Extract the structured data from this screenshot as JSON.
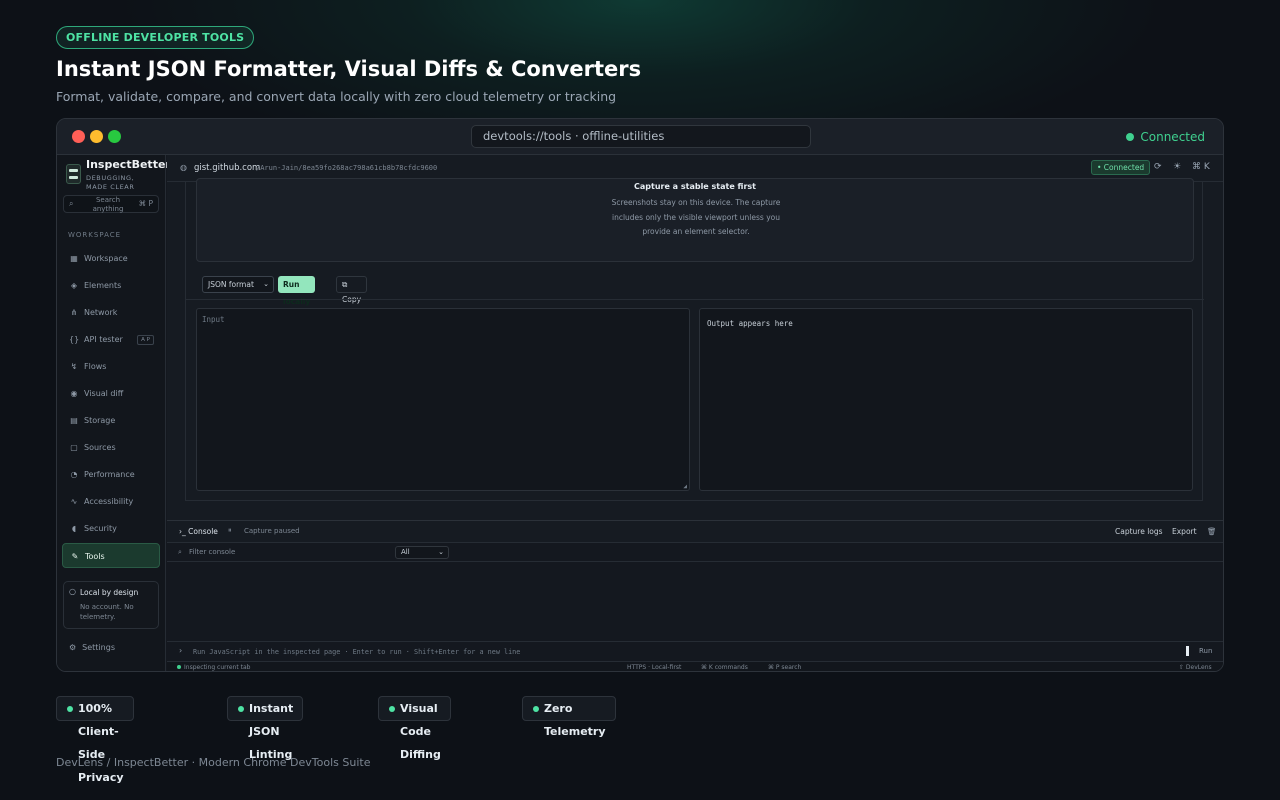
{
  "hero": {
    "badge": "OFFLINE DEVELOPER TOOLS",
    "title": "Instant JSON Formatter, Visual Diffs & Converters",
    "subtitle": "Format, validate, compare, and convert data locally with zero cloud telemetry or tracking"
  },
  "browser": {
    "url": "devtools://tools · offline-utilities",
    "status": "Connected"
  },
  "app": {
    "brand": "InspectBetter",
    "tagline": "DEBUGGING, MADE CLEAR",
    "search_placeholder": "Search anything",
    "search_kbd": "⌘ P",
    "section_label": "WORKSPACE",
    "nav": [
      {
        "label": "Workspace",
        "icon": "grid-icon",
        "glyph": "▦"
      },
      {
        "label": "Elements",
        "icon": "layers-icon",
        "glyph": "◈"
      },
      {
        "label": "Network",
        "icon": "network-icon",
        "glyph": "⋔"
      },
      {
        "label": "API tester",
        "icon": "braces-icon",
        "glyph": "{}",
        "badge": "A P"
      },
      {
        "label": "Flows",
        "icon": "flow-icon",
        "glyph": "↯"
      },
      {
        "label": "Visual diff",
        "icon": "camera-icon",
        "glyph": "◉"
      },
      {
        "label": "Storage",
        "icon": "database-icon",
        "glyph": "▤"
      },
      {
        "label": "Sources",
        "icon": "file-icon",
        "glyph": "▢"
      },
      {
        "label": "Performance",
        "icon": "gauge-icon",
        "glyph": "◔"
      },
      {
        "label": "Accessibility",
        "icon": "pulse-icon",
        "glyph": "∿"
      },
      {
        "label": "Security",
        "icon": "shield-icon",
        "glyph": "◖"
      },
      {
        "label": "Tools",
        "icon": "wrench-icon",
        "glyph": "✎",
        "active": true
      }
    ],
    "local_title": "Local by design",
    "local_desc": "No account. No telemetry.",
    "settings_label": "Settings",
    "topbar": {
      "host": "gist.github.com",
      "path": "/Arun-Jain/8ea59fo268ac798a61cb8b78cfdc9600",
      "connected": "• Connected",
      "icons": [
        "refresh-icon",
        "sun-icon",
        "command-icon"
      ],
      "kbd": "⌘ K"
    },
    "capture": {
      "title": "Capture a stable state first",
      "desc": "Screenshots stay on this device. The capture includes only the visible viewport unless you provide an element selector."
    },
    "tools": {
      "mode": "JSON format",
      "run": "Run locally",
      "copy": "Copy"
    },
    "input_placeholder": "Input",
    "output_placeholder": "Output appears here",
    "console": {
      "title": "Console",
      "pause_glyph": "⏸",
      "paused": "Capture paused",
      "capture_logs": "Capture logs",
      "export": "Export",
      "filter_placeholder": "Filter console",
      "level": "All",
      "prompt": "Run JavaScript in the inspected page · Enter to run · Shift+Enter for a new line",
      "run": "Run"
    },
    "status": {
      "left": "Inspecting current tab",
      "https": "HTTPS · Local-first",
      "commands": "⌘ K commands",
      "search": "⌘ P search",
      "brand": "⇧ DevLens"
    }
  },
  "features": [
    "100% Client-Side Privacy",
    "Instant JSON Linting",
    "Visual Code Diffing",
    "Zero Telemetry"
  ],
  "footer": "DevLens / InspectBetter · Modern Chrome DevTools Suite",
  "colors": {
    "accent": "#4ee3a4",
    "background": "#0d1117",
    "panel": "#161b22",
    "run_button": "#93e6bd"
  }
}
